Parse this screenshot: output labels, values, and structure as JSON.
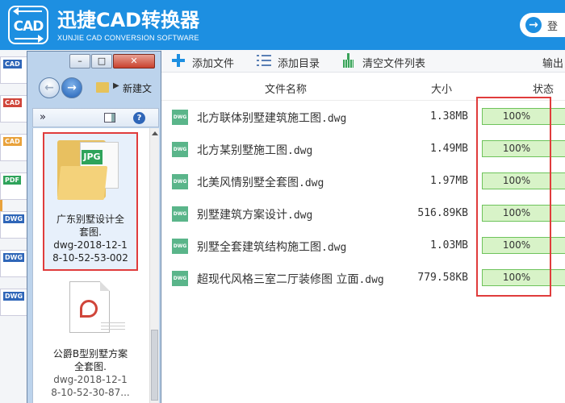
{
  "app": {
    "logo_text": "CAD",
    "title": "迅捷CAD转换器",
    "subtitle": "XUNJIE CAD CONVERSION SOFTWARE",
    "login_label": "登"
  },
  "toolbar": {
    "add_file": "添加文件",
    "add_folder": "添加目录",
    "clear_list": "清空文件列表",
    "output": "输出"
  },
  "table": {
    "headers": {
      "name": "文件名称",
      "size": "大小",
      "status": "状态"
    },
    "rows": [
      {
        "name": "北方联体别墅建筑施工图",
        "ext": ".dwg",
        "size": "1.38MB",
        "progress": "100%",
        "icon": "DWG"
      },
      {
        "name": "北方某别墅施工图",
        "ext": ".dwg",
        "size": "1.49MB",
        "progress": "100%",
        "icon": "DWG"
      },
      {
        "name": "北美风情别墅全套图",
        "ext": ".dwg",
        "size": "1.97MB",
        "progress": "100%",
        "icon": "DWG"
      },
      {
        "name": "别墅建筑方案设计",
        "ext": ".dwg",
        "size": "516.89KB",
        "progress": "100%",
        "icon": "DWG"
      },
      {
        "name": "别墅全套建筑结构施工图",
        "ext": ".dwg",
        "size": "1.03MB",
        "progress": "100%",
        "icon": "DWG"
      },
      {
        "name": "超现代风格三室二厅装修图 立面",
        "ext": ".dwg",
        "size": "779.58KB",
        "progress": "100%",
        "icon": "DWG"
      }
    ]
  },
  "explorer": {
    "address": "新建文",
    "more": "»",
    "help": "?",
    "files": [
      {
        "lines": [
          "广东别墅设计全",
          "套图.",
          "dwg-2018-12-1",
          "8-10-52-53-002"
        ],
        "tag": "JPG"
      },
      {
        "lines": [
          "公爵B型别墅方案",
          "全套图.",
          "dwg-2018-12-1",
          "8-10-52-30-87..."
        ]
      }
    ]
  },
  "side_icons": [
    {
      "label": "CAD",
      "color": "#2f66b8"
    },
    {
      "label": "CAD",
      "color": "#d0453a"
    },
    {
      "label": "CAD",
      "color": "#e9a23b"
    },
    {
      "label": "PDF",
      "color": "#2ea35a"
    },
    {
      "label": "DWG",
      "color": "#2f66b8"
    },
    {
      "label": "DWG",
      "color": "#2f66b8"
    },
    {
      "label": "DWG",
      "color": "#2f66b8"
    }
  ],
  "colors": {
    "brand": "#1d8fe1",
    "progress": "#d8f3c8",
    "highlight": "#e03c3c"
  }
}
